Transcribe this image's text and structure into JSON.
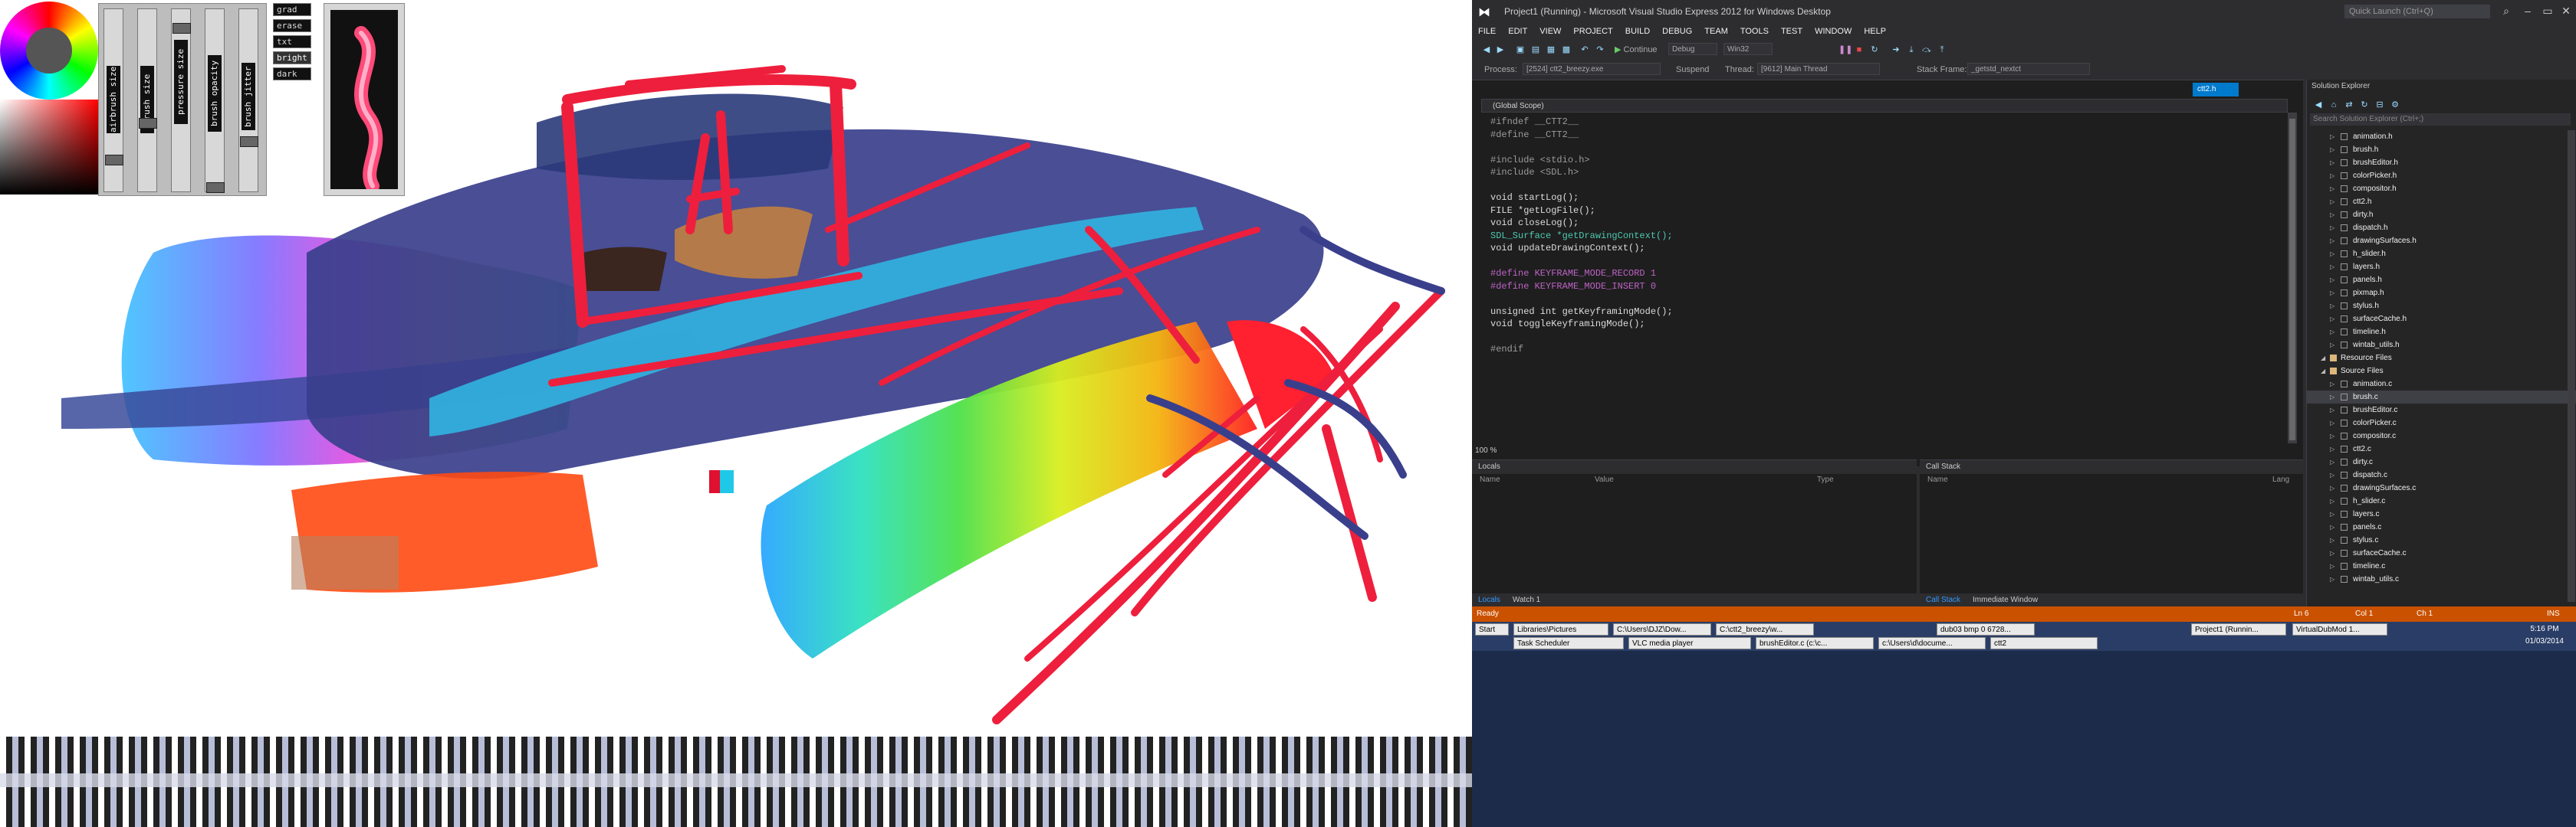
{
  "paint": {
    "sliders": [
      "airbrush size",
      "brush size",
      "pressure size",
      "brush opacity",
      "brush jitter"
    ],
    "tools": [
      "grad",
      "erase",
      "txt",
      "bright",
      "dark"
    ]
  },
  "ide": {
    "title": "Project1 (Running) - Microsoft Visual Studio Express 2012 for Windows Desktop",
    "quick_launch": "Quick Launch (Ctrl+Q)",
    "menu": [
      "FILE",
      "EDIT",
      "VIEW",
      "PROJECT",
      "BUILD",
      "DEBUG",
      "TEAM",
      "TOOLS",
      "TEST",
      "WINDOW",
      "HELP"
    ],
    "toolbar": {
      "continue": "Continue",
      "config": "Debug",
      "platform": "Win32",
      "process_label": "Process:",
      "process_value": "[2524] ctt2_breezy.exe",
      "suspend": "Suspend",
      "thread_label": "Thread:",
      "thread_value": "[9612] Main Thread",
      "stack_label": "Stack Frame:",
      "stack_value": "_getstd_nextct"
    },
    "doc_tab": "ctt2.h",
    "scope": "(Global Scope)",
    "code_lines": [
      "#ifndef __CTT2__",
      "#define __CTT2__",
      "",
      "#include <stdio.h>",
      "#include <SDL.h>",
      "",
      "void startLog();",
      "FILE *getLogFile();",
      "void closeLog();",
      "SDL_Surface *getDrawingContext();",
      "void updateDrawingContext();",
      "",
      "#define KEYFRAME_MODE_RECORD 1",
      "#define KEYFRAME_MODE_INSERT 0",
      "",
      "unsigned int getKeyframingMode();",
      "void toggleKeyframingMode();",
      "",
      "#endif"
    ],
    "zoom": "100 %",
    "locals": {
      "title": "Locals",
      "cols": [
        "Name",
        "Value",
        "Type"
      ],
      "tabs": [
        "Locals",
        "Watch 1"
      ]
    },
    "callstack": {
      "title": "Call Stack",
      "cols": [
        "Name",
        "Lang"
      ],
      "tabs": [
        "Call Stack",
        "Immediate Window"
      ]
    },
    "solution_explorer": {
      "title": "Solution Explorer",
      "search": "Search Solution Explorer (Ctrl+;)",
      "items": [
        {
          "label": "animation.h"
        },
        {
          "label": "brush.h"
        },
        {
          "label": "brushEditor.h"
        },
        {
          "label": "colorPicker.h"
        },
        {
          "label": "compositor.h"
        },
        {
          "label": "ctt2.h"
        },
        {
          "label": "dirty.h"
        },
        {
          "label": "dispatch.h"
        },
        {
          "label": "drawingSurfaces.h"
        },
        {
          "label": "h_slider.h"
        },
        {
          "label": "layers.h"
        },
        {
          "label": "panels.h"
        },
        {
          "label": "pixmap.h"
        },
        {
          "label": "stylus.h"
        },
        {
          "label": "surfaceCache.h"
        },
        {
          "label": "timeline.h"
        },
        {
          "label": "wintab_utils.h"
        },
        {
          "label": "Resource Files",
          "folder": true
        },
        {
          "label": "Source Files",
          "folder": true
        },
        {
          "label": "animation.c"
        },
        {
          "label": "brush.c",
          "selected": true
        },
        {
          "label": "brushEditor.c"
        },
        {
          "label": "colorPicker.c"
        },
        {
          "label": "compositor.c"
        },
        {
          "label": "ctt2.c"
        },
        {
          "label": "dirty.c"
        },
        {
          "label": "dispatch.c"
        },
        {
          "label": "drawingSurfaces.c"
        },
        {
          "label": "h_slider.c"
        },
        {
          "label": "layers.c"
        },
        {
          "label": "panels.c"
        },
        {
          "label": "stylus.c"
        },
        {
          "label": "surfaceCache.c"
        },
        {
          "label": "timeline.c"
        },
        {
          "label": "wintab_utils.c"
        }
      ]
    },
    "status": {
      "state": "Ready",
      "ln": "Ln 6",
      "col": "Col 1",
      "ch": "Ch 1",
      "ins": "INS"
    },
    "taskbar": {
      "start": "Start",
      "row1": [
        "Libraries\\Pictures",
        "C:\\Users\\DJZ\\Dow...",
        "C:\\ctt2_breezy\\w...",
        "dub03 bmp 0 6728...",
        "Project1 (Runnin...",
        "VirtualDubMod 1..."
      ],
      "row2": [
        "Task Scheduler",
        "VLC media player",
        "brushEditor.c (c:\\c...",
        "c:\\Users\\d\\docume...",
        "ctt2"
      ],
      "time": "5:16 PM",
      "date": "01/03/2014"
    }
  }
}
